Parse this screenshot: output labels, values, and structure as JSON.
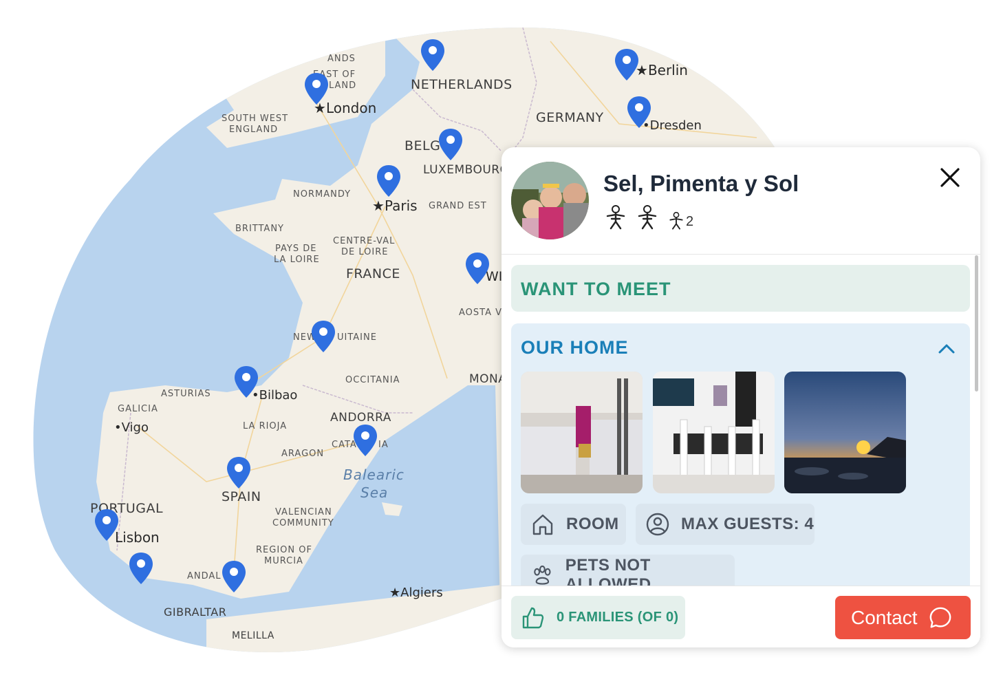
{
  "map": {
    "countries": [
      "NETHERLANDS",
      "GERMANY",
      "BELGIUM",
      "LUXEMBOURG",
      "FRANCE",
      "ANDORRA",
      "SPAIN",
      "PORTUGAL",
      "GIBRALTAR",
      "MONACO",
      "MELILLA"
    ],
    "regions": [
      "ENGLANDS",
      "EAST OF ENGLAND",
      "SOUTH WEST ENGLAND",
      "NORMANDY",
      "GRAND EST",
      "BRITTANY",
      "PAYS DE LA LOIRE",
      "CENTRE-VAL DE LOIRE",
      "AOSTA V",
      "NOUVELLE-AQUITAINE",
      "OCCITANIA",
      "ASTURIAS",
      "GALICIA",
      "LA RIOJA",
      "ARAGON",
      "CATALONIA",
      "VALENCIAN COMMUNITY",
      "REGION OF MURCIA",
      "ANDALUSIA"
    ],
    "cities": [
      "London",
      "Berlin",
      "Dresden",
      "Paris",
      "Bilbao",
      "Vigo",
      "Lisbon",
      "Algiers"
    ],
    "seas": [
      "Balearic Sea"
    ],
    "label_text": {
      "c_netherlands": "NETHERLANDS",
      "c_germany": "GERMANY",
      "c_belgium": "BELG",
      "c_luxembourg": "LUXEMBOURG",
      "c_france": "FRANCE",
      "c_andorra": "ANDORRA",
      "c_spain": "SPAIN",
      "c_portugal": "PORTUGAL",
      "c_gibraltar": "GIBRALTAR",
      "c_monaco": "MONA",
      "c_melilla": "MELILLA",
      "r_englands": "ANDS",
      "r_east_l1": "EAST OF",
      "r_east_l2": "LAND",
      "r_sw_l1": "SOUTH WEST",
      "r_sw_l2": "ENGLAND",
      "r_normandy": "NORMANDY",
      "r_grandest": "GRAND EST",
      "r_brittany": "BRITTANY",
      "r_pdl_l1": "PAYS DE",
      "r_pdl_l2": "LA LOIRE",
      "r_cvl_l1": "CENTRE-VAL",
      "r_cvl_l2": "DE LOIRE",
      "r_aosta": "AOSTA V",
      "r_naq_a": "NEW",
      "r_naq_b": "UITAINE",
      "r_occitania": "OCCITANIA",
      "r_asturias": "ASTURIAS",
      "r_galicia": "GALICIA",
      "r_larioja": "LA RIOJA",
      "r_aragon": "ARAGON",
      "r_catalonia_a": "CATA",
      "r_catalonia_b": "IA",
      "r_val_l1": "VALENCIAN",
      "r_val_l2": "COMMUNITY",
      "r_mur_l1": "REGION OF",
      "r_mur_l2": "MURCIA",
      "r_andalusia": "ANDAL",
      "city_london": "London",
      "city_berlin": "Berlin",
      "city_dresden": "Dresden",
      "city_paris": "Paris",
      "city_bilbao": "Bilbao",
      "city_vigo": "Vigo",
      "city_lisbon": "Lisbon",
      "city_algiers": "Algiers",
      "city_swit": "WIT",
      "sea_l1": "Balearic",
      "sea_l2": "Sea"
    },
    "pin_color": "#2f6fe0",
    "sea_color": "#b8d3ee",
    "land_color": "#f3efe6"
  },
  "card": {
    "title": "Sel, Pimenta y Sol",
    "adults_count": 2,
    "children_label": "2",
    "sections": {
      "want_to_meet": "WANT TO MEET",
      "our_home": "OUR HOME"
    },
    "photos": [
      "bedroom-photo",
      "dining-room-photo",
      "sunset-beach-photo"
    ],
    "tags": {
      "room": "ROOM",
      "max_guests": "MAX GUESTS: 4",
      "pets": "PETS NOT ALLOWED"
    },
    "footer": {
      "families": "0 FAMILIES (OF 0)",
      "contact": "Contact"
    },
    "colors": {
      "accent_green": "#2a9477",
      "accent_blue": "#1a7fb8",
      "contact_red": "#ee5241"
    }
  }
}
